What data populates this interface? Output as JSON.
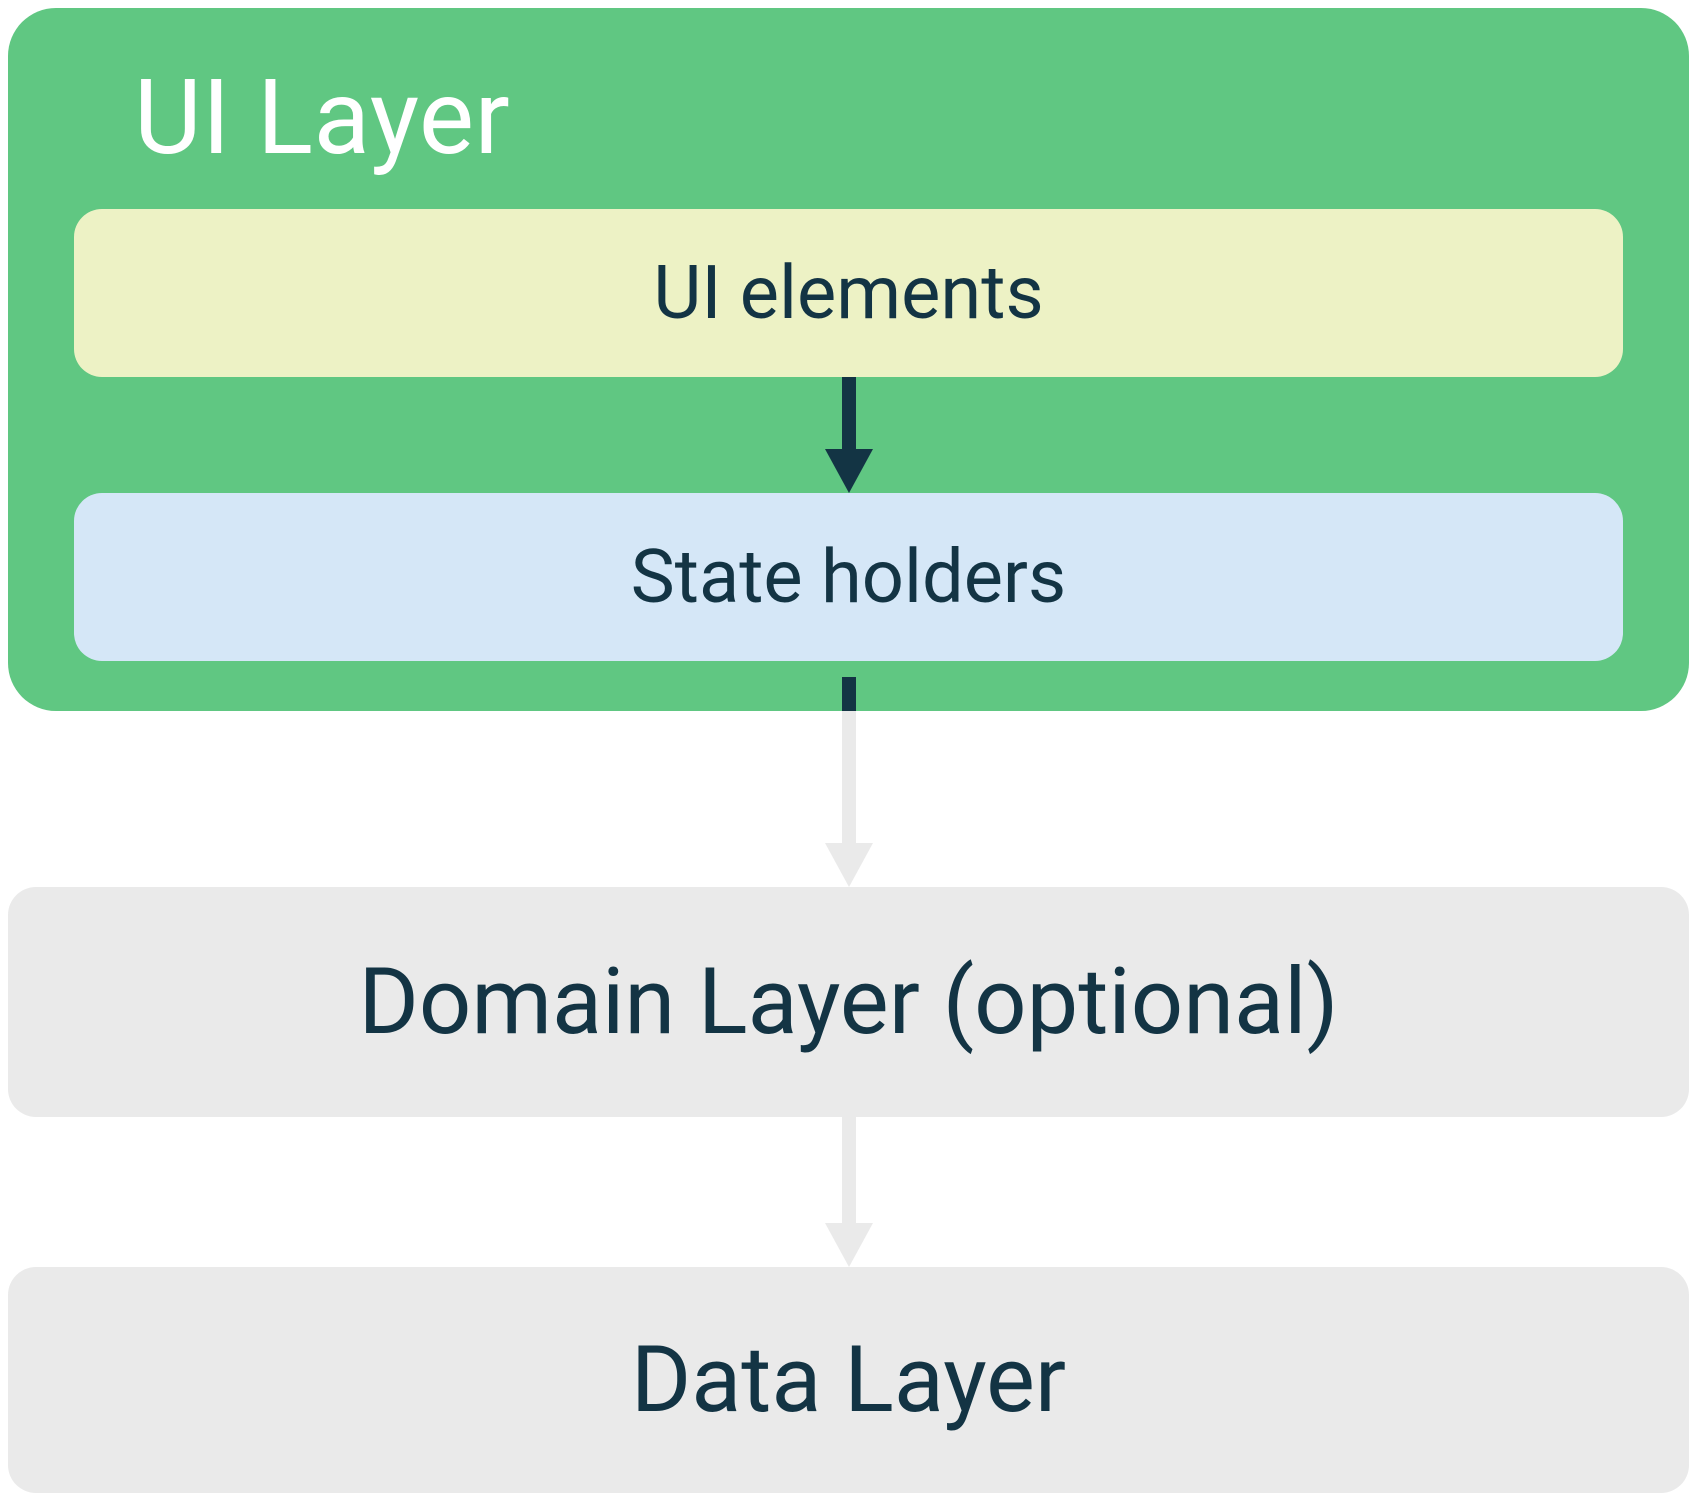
{
  "diagram": {
    "ui_layer": {
      "title": "UI Layer",
      "ui_elements_label": "UI elements",
      "state_holders_label": "State holders"
    },
    "domain_layer_label": "Domain Layer (optional)",
    "data_layer_label": "Data Layer"
  },
  "colors": {
    "ui_layer_bg": "#60c782",
    "ui_elements_bg": "#edf2c5",
    "state_holders_bg": "#d5e7f7",
    "layer_box_bg": "#eaeaea",
    "text_dark": "#133444",
    "text_white": "#ffffff",
    "arrow_dark": "#133444",
    "arrow_light": "#eaeaea"
  }
}
